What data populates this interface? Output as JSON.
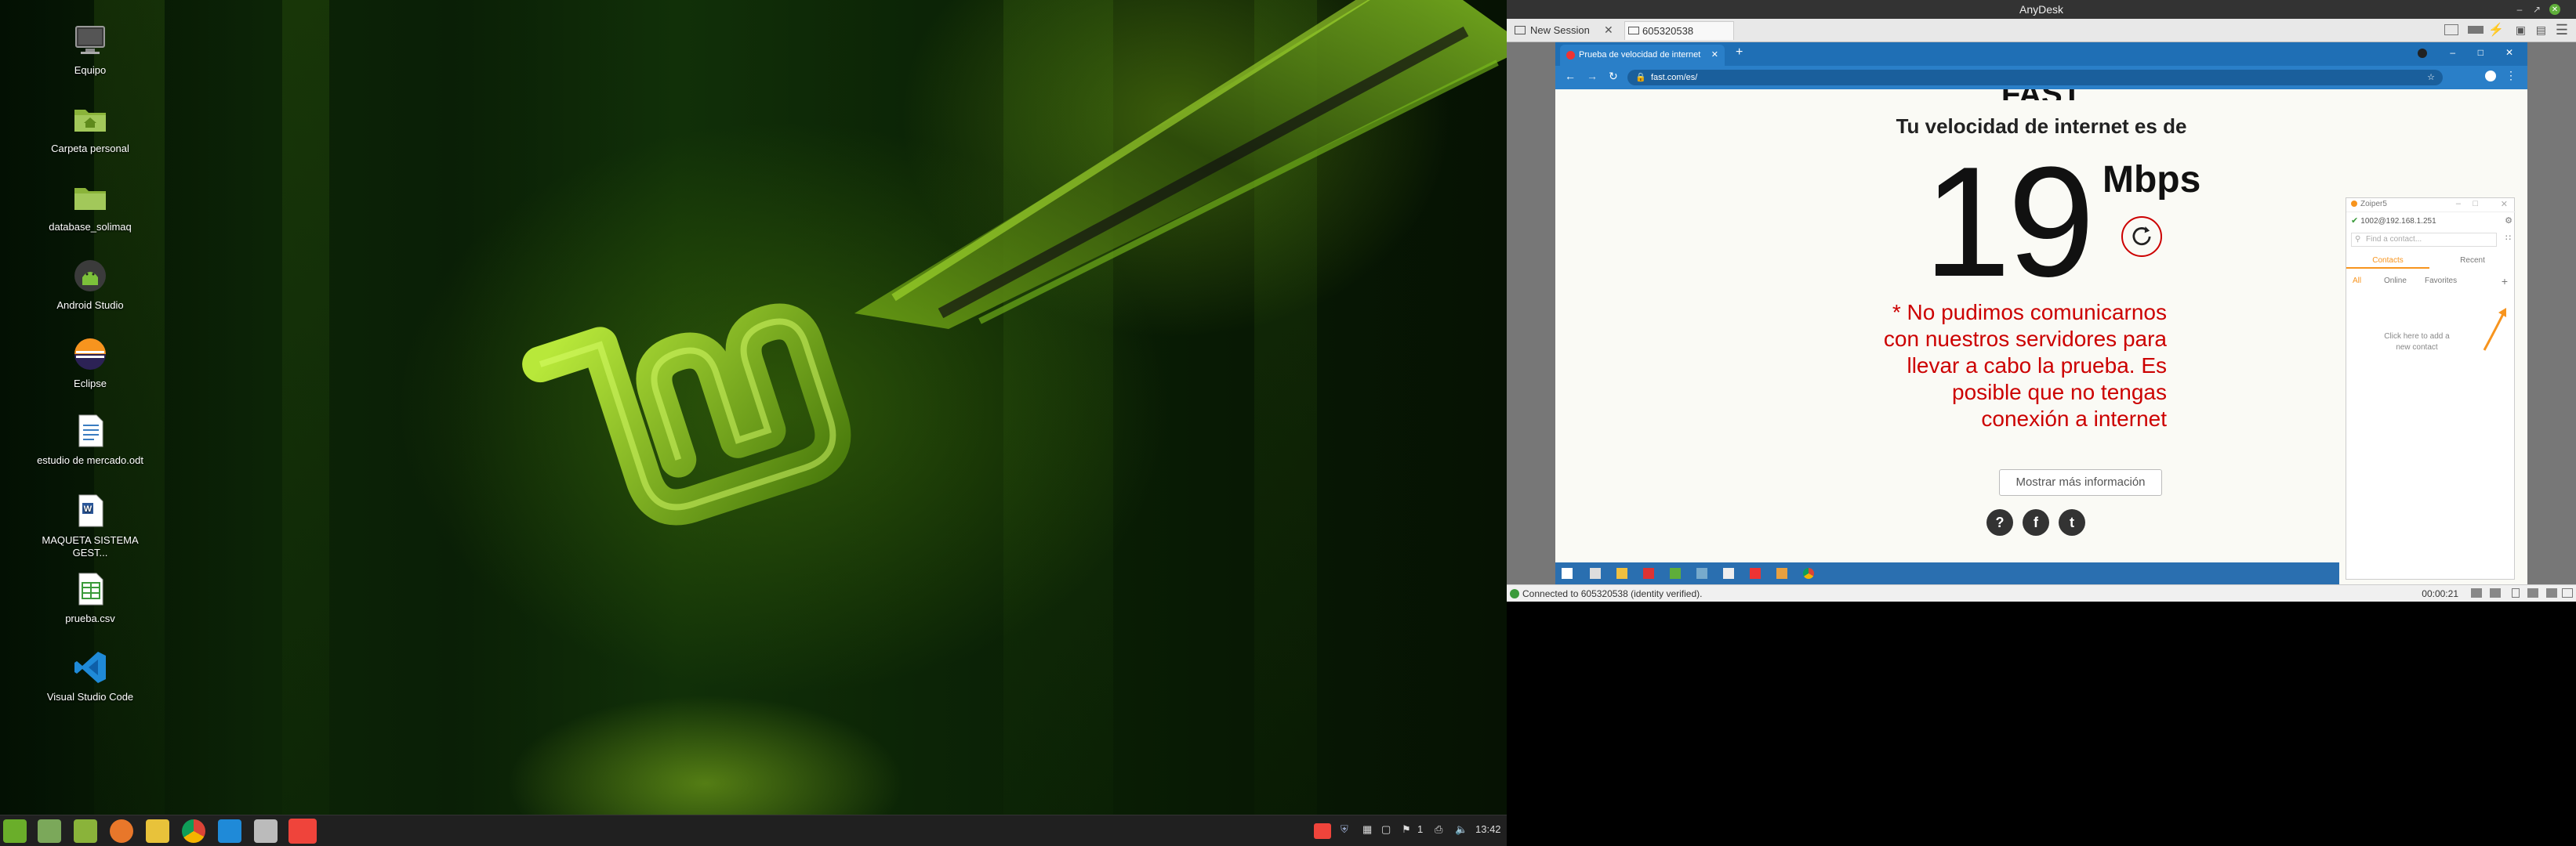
{
  "desktop": {
    "icons": [
      {
        "label": "Equipo",
        "icon": "computer-icon"
      },
      {
        "label": "Carpeta personal",
        "icon": "home-folder-icon"
      },
      {
        "label": "database_solimaq",
        "icon": "folder-icon"
      },
      {
        "label": "Android Studio",
        "icon": "android-studio-icon"
      },
      {
        "label": "Eclipse",
        "icon": "eclipse-icon"
      },
      {
        "label": "estudio de mercado.odt",
        "icon": "document-icon"
      },
      {
        "label": "MAQUETA SISTEMA GEST...",
        "icon": "word-document-icon"
      },
      {
        "label": "prueba.csv",
        "icon": "spreadsheet-icon"
      },
      {
        "label": "Visual Studio Code",
        "icon": "vscode-icon"
      }
    ]
  },
  "taskbar": {
    "apps": [
      "menu-icon",
      "files-icon",
      "folder-icon",
      "firefox-icon",
      "notes-icon",
      "chrome-icon",
      "vscode-icon",
      "calculator-icon",
      "anydesk-icon"
    ],
    "tray_count": "1",
    "clock": "13:42"
  },
  "anydesk": {
    "title": "AnyDesk",
    "tabs": [
      {
        "label": "New Session",
        "icon": "session-icon"
      },
      {
        "label": "605320538",
        "icon": "monitor-icon"
      }
    ],
    "status": "Connected to 605320538 (identity verified).",
    "timer": "00:00:21"
  },
  "remote": {
    "chrome": {
      "tab_title": "Prueba de velocidad de internet",
      "url": "fast.com/es/"
    },
    "fast": {
      "logo_partial": "FAST",
      "heading": "Tu velocidad de internet es de",
      "speed": "19",
      "unit": "Mbps",
      "error_lines": [
        "* No pudimos comunicarnos",
        "con nuestros servidores para",
        "llevar a cabo la prueba. Es",
        "posible que no tengas",
        "conexión a internet"
      ],
      "more_button": "Mostrar más información",
      "social": [
        "?",
        "f",
        "t"
      ]
    },
    "zoiper": {
      "title": "Zoiper5",
      "account": "1002@192.168.1.251",
      "search_placeholder": "Find a contact...",
      "tabs": [
        "Contacts",
        "Recent"
      ],
      "filters": [
        "All",
        "Online",
        "Favorites"
      ],
      "empty_hint_1": "Click here to add a",
      "empty_hint_2": "new contact"
    }
  },
  "colors": {
    "accent_red": "#cc0000",
    "anydesk_red": "#ef443b",
    "chrome_blue": "#2a7fc8",
    "mint_green": "#8fbf1f"
  }
}
